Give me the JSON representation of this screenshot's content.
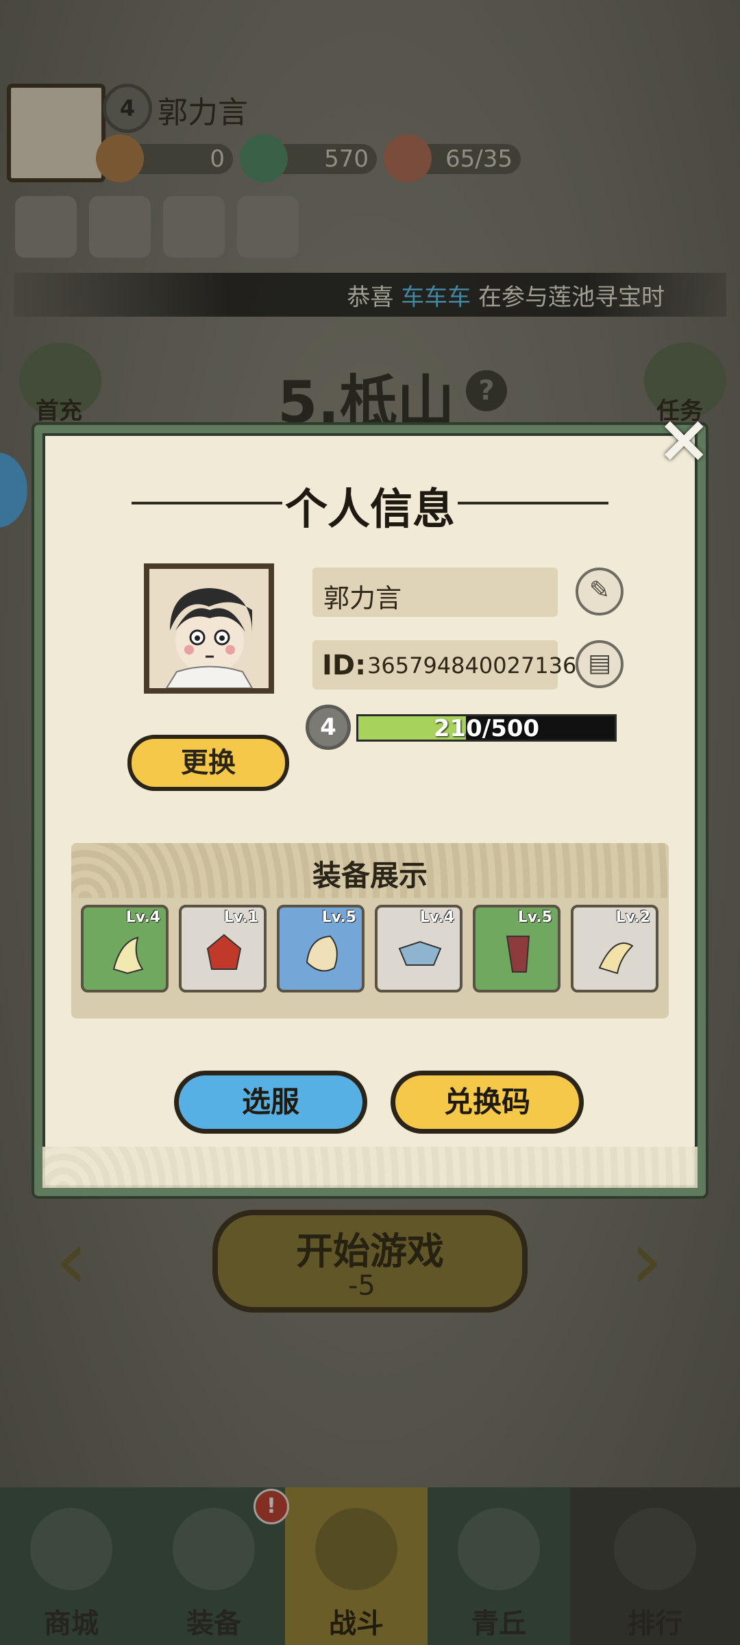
{
  "player": {
    "name": "郭力言",
    "level": "4"
  },
  "resources": [
    {
      "icon": "gift-box-icon",
      "value": "0"
    },
    {
      "icon": "jade-dragon-icon",
      "value": "570"
    },
    {
      "icon": "peach-stamina-icon",
      "value": "65/35"
    }
  ],
  "ticker": {
    "prefix": "恭喜 ",
    "highlight": "车车车",
    "suffix": " 在参与莲池寻宝时"
  },
  "stage": {
    "title": "5.柢山"
  },
  "side": {
    "left_label": "首充",
    "right_label": "任务"
  },
  "start": {
    "label": "开始游戏",
    "cost": "-5"
  },
  "tabs": [
    {
      "label": "商城"
    },
    {
      "label": "装备"
    },
    {
      "label": "战斗"
    },
    {
      "label": "青丘"
    },
    {
      "label": "排行"
    }
  ],
  "alert": "!",
  "dialog": {
    "title": "个人信息",
    "name": "郭力言",
    "id_label": "ID:",
    "id_value": "365794840027136",
    "level": "4",
    "xp_text": "210/500",
    "xp_fraction": 0.42,
    "change_label": "更换",
    "equip_title": "装备展示",
    "equipment": [
      {
        "level": "Lv.4",
        "rarity": "green"
      },
      {
        "level": "Lv.1",
        "rarity": "grey"
      },
      {
        "level": "Lv.5",
        "rarity": "blue"
      },
      {
        "level": "Lv.4",
        "rarity": "grey"
      },
      {
        "level": "Lv.5",
        "rarity": "green"
      },
      {
        "level": "Lv.2",
        "rarity": "grey"
      }
    ],
    "server_button": "选服",
    "redeem_button": "兑换码",
    "close": "×"
  },
  "colors": {
    "accent_yellow": "#f5c84a",
    "accent_blue": "#57b0e4",
    "frame_green": "#5f7a5c",
    "xp_green": "#a7d25c",
    "ticker_highlight": "#5bc8f5"
  }
}
